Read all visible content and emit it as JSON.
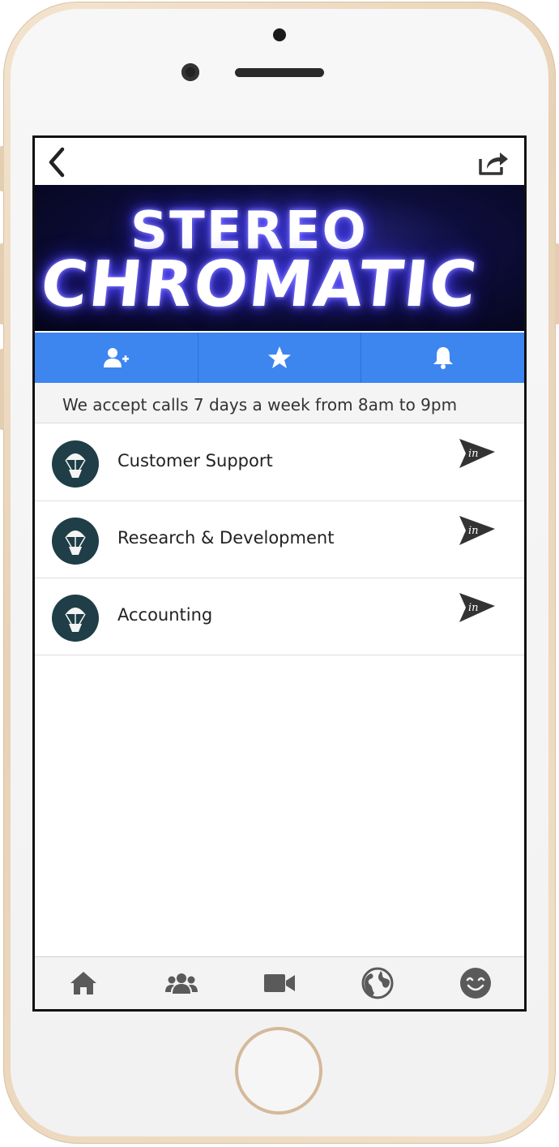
{
  "app": {
    "banner_line1": "STEREO",
    "banner_line2": "CHROMATIC",
    "accent_color": "#3d86f0"
  },
  "topbar": {
    "back_icon": "chevron-left-icon",
    "share_icon": "share-icon"
  },
  "actions": [
    {
      "icon": "add-user-icon"
    },
    {
      "icon": "star-icon"
    },
    {
      "icon": "bell-icon"
    }
  ],
  "notice": "We accept calls 7 days a week from 8am to 9pm",
  "departments": [
    {
      "label": "Customer Support"
    },
    {
      "label": "Research & Development"
    },
    {
      "label": "Accounting"
    }
  ],
  "tabs": [
    {
      "icon": "home-icon"
    },
    {
      "icon": "group-icon"
    },
    {
      "icon": "video-camera-icon"
    },
    {
      "icon": "globe-icon"
    },
    {
      "icon": "smiley-icon"
    }
  ]
}
